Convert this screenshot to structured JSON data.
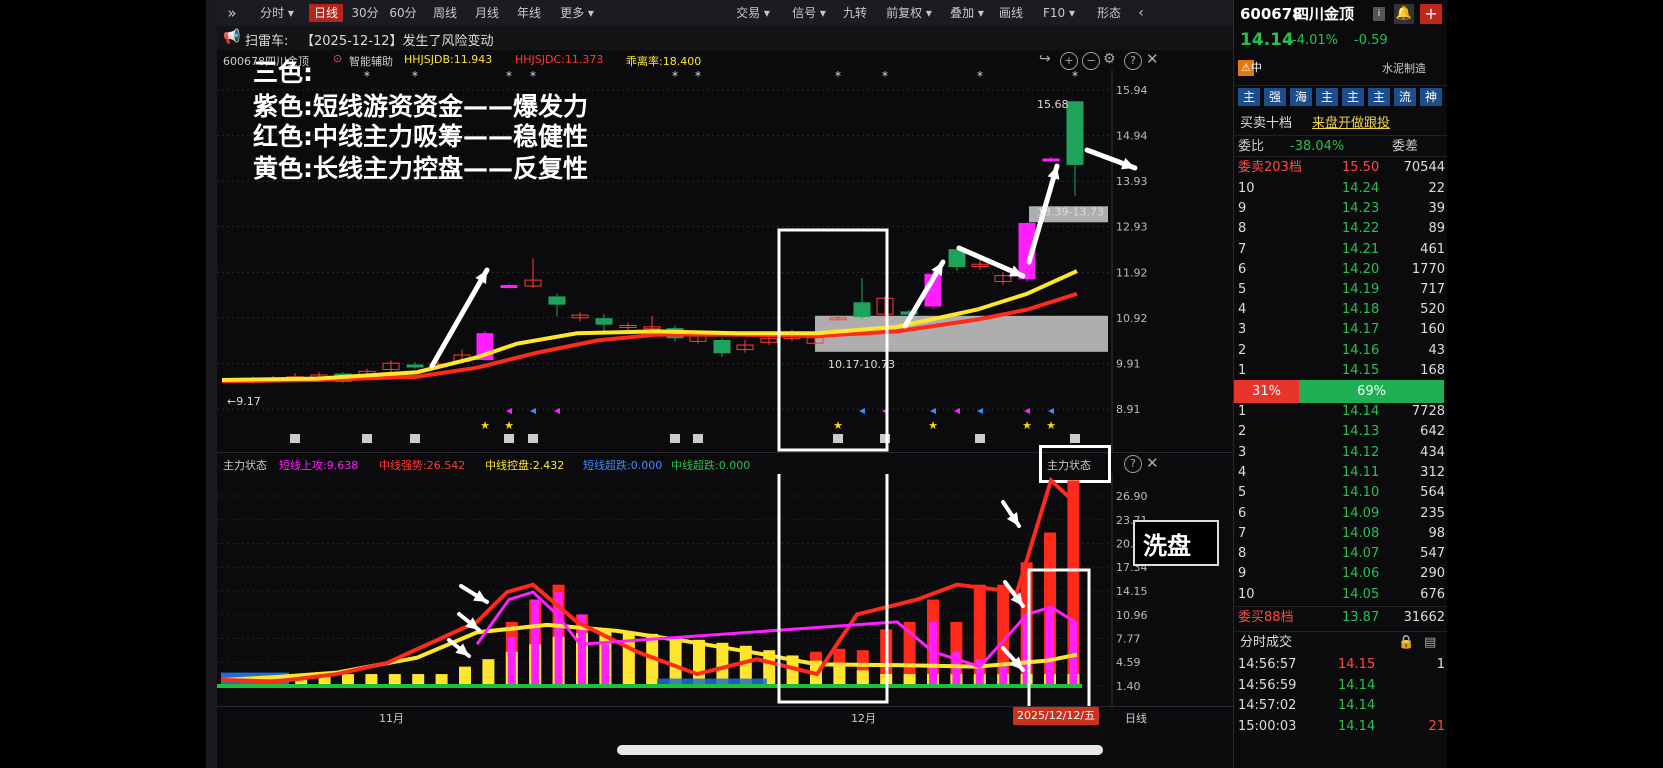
{
  "toolbar": {
    "items": [
      "分时",
      "日线",
      "30分",
      "60分",
      "周线",
      "月线",
      "年线",
      "更多"
    ],
    "right_items": [
      "交易",
      "信号",
      "九转",
      "前复权",
      "叠加",
      "画线",
      "F10",
      "形态"
    ],
    "expand_icon": "double-chevron-right-icon"
  },
  "notice": {
    "label": "扫雷车:",
    "text": "【2025-12-12】发生了风险变动"
  },
  "main_chart": {
    "code": "600678四川金顶",
    "assist": "智能辅助",
    "ind1": "HHJSJDB:11.943",
    "ind2": "HHJSJDC:11.373",
    "ind3": "乖离率:18.400",
    "yticks": [
      "15.94",
      "14.94",
      "13.93",
      "12.93",
      "11.92",
      "10.92",
      "9.91",
      "8.91"
    ],
    "high_label": "15.68",
    "low_label": "9.17",
    "zone1": "10.17-10.73",
    "zone2": "13.39-13.73"
  },
  "annotations": {
    "line0": "三色:",
    "line1": "紫色:短线游资资金——爆发力",
    "line2": "红色:中线主力吸筹——稳健性",
    "line3": "黄色:长线主力控盘——反复性",
    "wash": "洗盘"
  },
  "sub_chart": {
    "title": "主力状态",
    "v1": "短线上攻:9.638",
    "v2": "中线强势:26.542",
    "v3": "中线控盘:2.432",
    "v4": "短线超跌:0.000",
    "v5": "中线超跌:0.000",
    "btn": "主力状态",
    "yticks": [
      "26.90",
      "23.71",
      "20.53",
      "17.34",
      "14.15",
      "10.96",
      "7.77",
      "4.59",
      "1.40"
    ]
  },
  "xaxis": {
    "nov": "11月",
    "dec": "12月",
    "date": "2025/12/12/五",
    "period": "日线"
  },
  "quote": {
    "code": "600678",
    "name": "四川金顶",
    "price": "14.14",
    "pct": "-4.01%",
    "chg": "-0.59",
    "risk": "中",
    "sector": "水泥制造",
    "tags": [
      "主",
      "强",
      "海",
      "主",
      "主",
      "主",
      "流",
      "神"
    ],
    "tabs": [
      "买卖十档",
      "来盘开做跟投"
    ],
    "wb_label": "委比",
    "wb_value": "-38.04%",
    "wc_label": "委差",
    "sell_header": "委卖203档",
    "sell_header_price": "15.50",
    "sell_header_vol": "70544",
    "asks": [
      {
        "lvl": "10",
        "price": "14.24",
        "vol": "22"
      },
      {
        "lvl": "9",
        "price": "14.23",
        "vol": "39"
      },
      {
        "lvl": "8",
        "price": "14.22",
        "vol": "89"
      },
      {
        "lvl": "7",
        "price": "14.21",
        "vol": "461"
      },
      {
        "lvl": "6",
        "price": "14.20",
        "vol": "1770"
      },
      {
        "lvl": "5",
        "price": "14.19",
        "vol": "717"
      },
      {
        "lvl": "4",
        "price": "14.18",
        "vol": "520"
      },
      {
        "lvl": "3",
        "price": "14.17",
        "vol": "160"
      },
      {
        "lvl": "2",
        "price": "14.16",
        "vol": "43"
      },
      {
        "lvl": "1",
        "price": "14.15",
        "vol": "168"
      }
    ],
    "ratio_sell": "31%",
    "ratio_buy": "69%",
    "ratio_sell_frac": 0.31,
    "bids": [
      {
        "lvl": "1",
        "price": "14.14",
        "vol": "7728"
      },
      {
        "lvl": "2",
        "price": "14.13",
        "vol": "642"
      },
      {
        "lvl": "3",
        "price": "14.12",
        "vol": "434"
      },
      {
        "lvl": "4",
        "price": "14.11",
        "vol": "312"
      },
      {
        "lvl": "5",
        "price": "14.10",
        "vol": "564"
      },
      {
        "lvl": "6",
        "price": "14.09",
        "vol": "235"
      },
      {
        "lvl": "7",
        "price": "14.08",
        "vol": "98"
      },
      {
        "lvl": "8",
        "price": "14.07",
        "vol": "547"
      },
      {
        "lvl": "9",
        "price": "14.06",
        "vol": "290"
      },
      {
        "lvl": "10",
        "price": "14.05",
        "vol": "676"
      }
    ],
    "buy_header": "委买88档",
    "buy_header_price": "13.87",
    "buy_header_vol": "31662",
    "ticks_title": "分时成交",
    "ticks": [
      {
        "time": "14:56:57",
        "price": "14.15",
        "vol": "1"
      },
      {
        "time": "14:56:59",
        "price": "14.14",
        "vol": ""
      },
      {
        "time": "14:57:02",
        "price": "14.14",
        "vol": ""
      },
      {
        "time": "15:00:03",
        "price": "14.14",
        "vol": "21"
      }
    ]
  },
  "colors": {
    "up": "#ff3b30",
    "down": "#1fa35c",
    "magenta": "#ff1fff",
    "yellow": "#ffe62e",
    "red_line": "#ff2a1a"
  }
}
